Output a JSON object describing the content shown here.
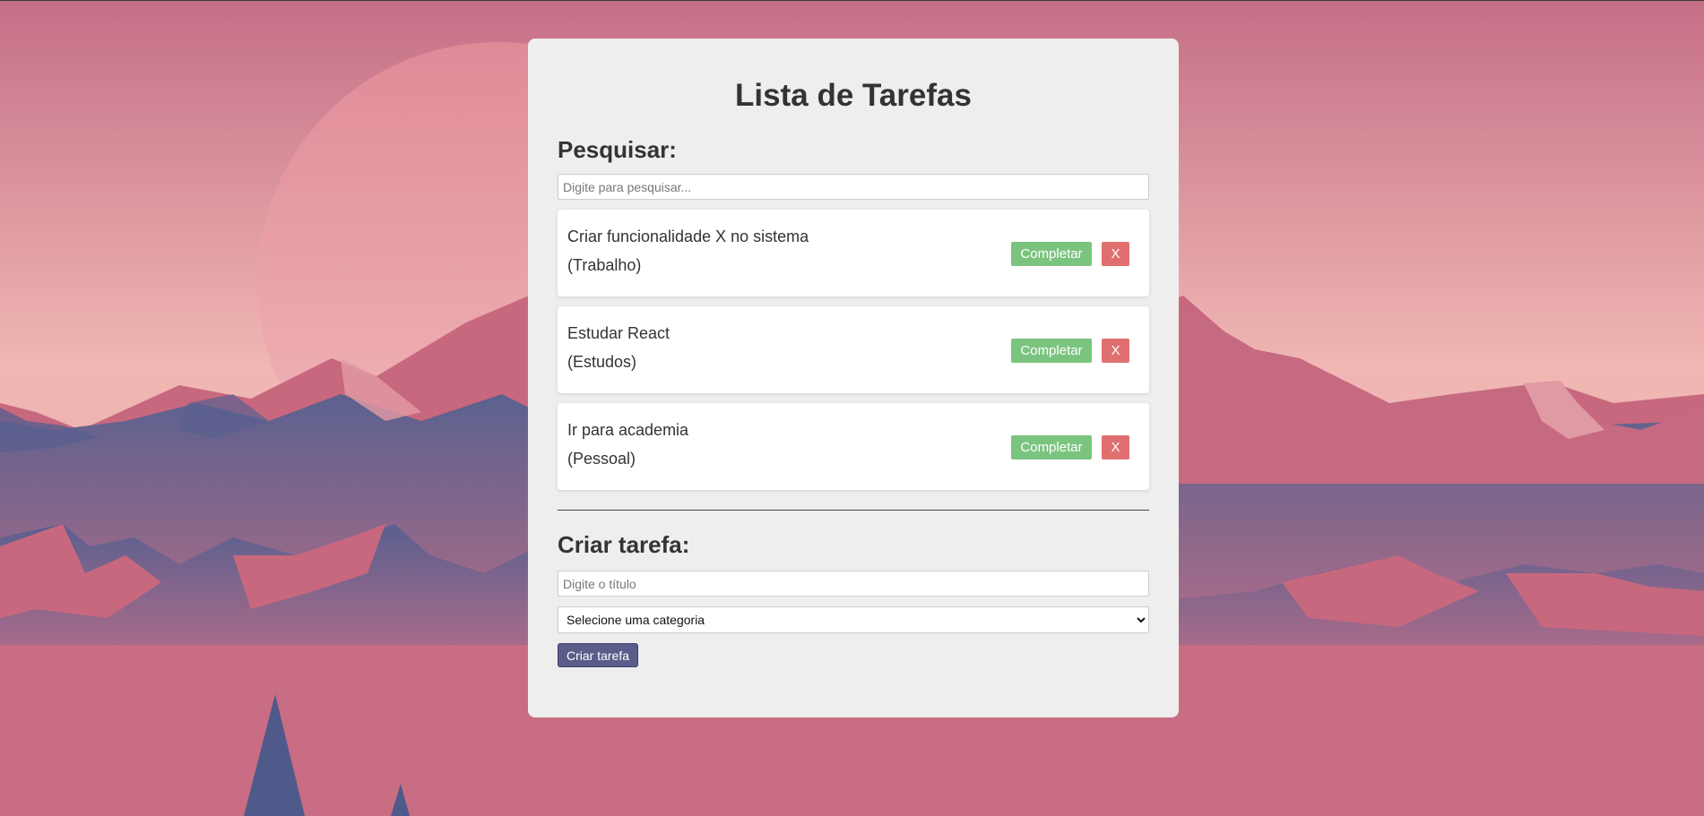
{
  "colors": {
    "sky_top": "#c56f87",
    "sky_bottom": "#f0b7b3",
    "mountain_blue": "#4f5a8a",
    "mountain_pink": "#c8687f",
    "panel": "#eeeeee",
    "complete_button": "#7bc47f",
    "remove_button": "#e07070",
    "create_button": "#5a5c8a"
  },
  "app": {
    "title": "Lista de Tarefas"
  },
  "search": {
    "heading": "Pesquisar:",
    "placeholder": "Digite para pesquisar..."
  },
  "todos": [
    {
      "title": "Criar funcionalidade X no sistema",
      "category": "(Trabalho)",
      "complete_label": "Completar",
      "remove_label": "X"
    },
    {
      "title": "Estudar React",
      "category": "(Estudos)",
      "complete_label": "Completar",
      "remove_label": "X"
    },
    {
      "title": "Ir para academia",
      "category": "(Pessoal)",
      "complete_label": "Completar",
      "remove_label": "X"
    }
  ],
  "create": {
    "heading": "Criar tarefa:",
    "title_placeholder": "Digite o título",
    "category_selected": "Selecione uma categoria",
    "submit_label": "Criar tarefa"
  }
}
